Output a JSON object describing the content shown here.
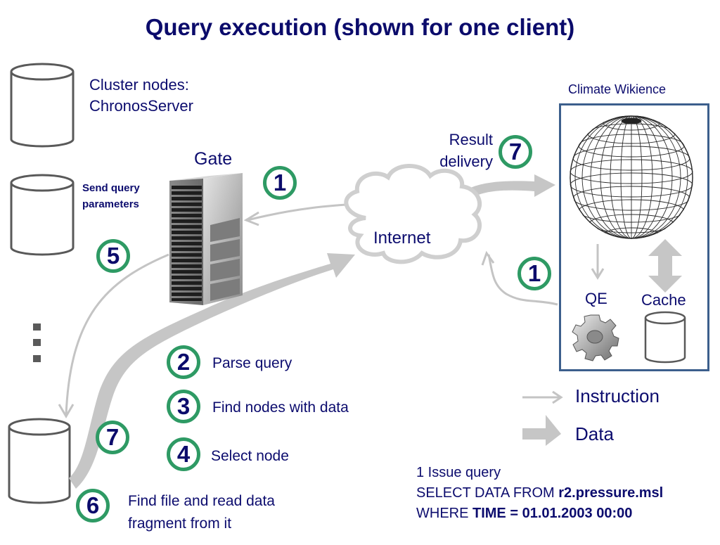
{
  "title": "Query execution (shown for one client)",
  "cluster_label": [
    "Cluster nodes:",
    "ChronosServer"
  ],
  "send_query_label": [
    "Send query",
    "parameters"
  ],
  "gate_label": "Gate",
  "internet_label": "Internet",
  "result_delivery_label": [
    "Result",
    "delivery"
  ],
  "climate_wikience": {
    "title": "Climate Wikience",
    "qe_label": "QE",
    "cache_label": "Cache"
  },
  "ellipsis": "⋮",
  "steps": [
    {
      "num": "1",
      "label": ""
    },
    {
      "num": "1",
      "label": ""
    },
    {
      "num": "2",
      "label": "Parse query"
    },
    {
      "num": "3",
      "label": "Find nodes with data"
    },
    {
      "num": "4",
      "label": "Select node"
    },
    {
      "num": "5",
      "label": ""
    },
    {
      "num": "6",
      "label": "Find file and read data",
      "label2": "fragment from it"
    },
    {
      "num": "7",
      "label": ""
    },
    {
      "num": "7",
      "label": ""
    }
  ],
  "legend": {
    "instruction": "Instruction",
    "data": "Data"
  },
  "query": {
    "line1": "1 Issue query",
    "line2_prefix": "SELECT DATA FROM ",
    "line2_bold": "r2.pressure.msl",
    "line3_prefix": "WHERE ",
    "line3_bold": "TIME = 01.01.2003 00:00"
  },
  "colors": {
    "text": "#0c0c6e",
    "badge_ring": "#2e9a64",
    "arrow_gray": "#c4c4c4",
    "box_border": "#3c5f8c",
    "cylinder": "#595959"
  }
}
